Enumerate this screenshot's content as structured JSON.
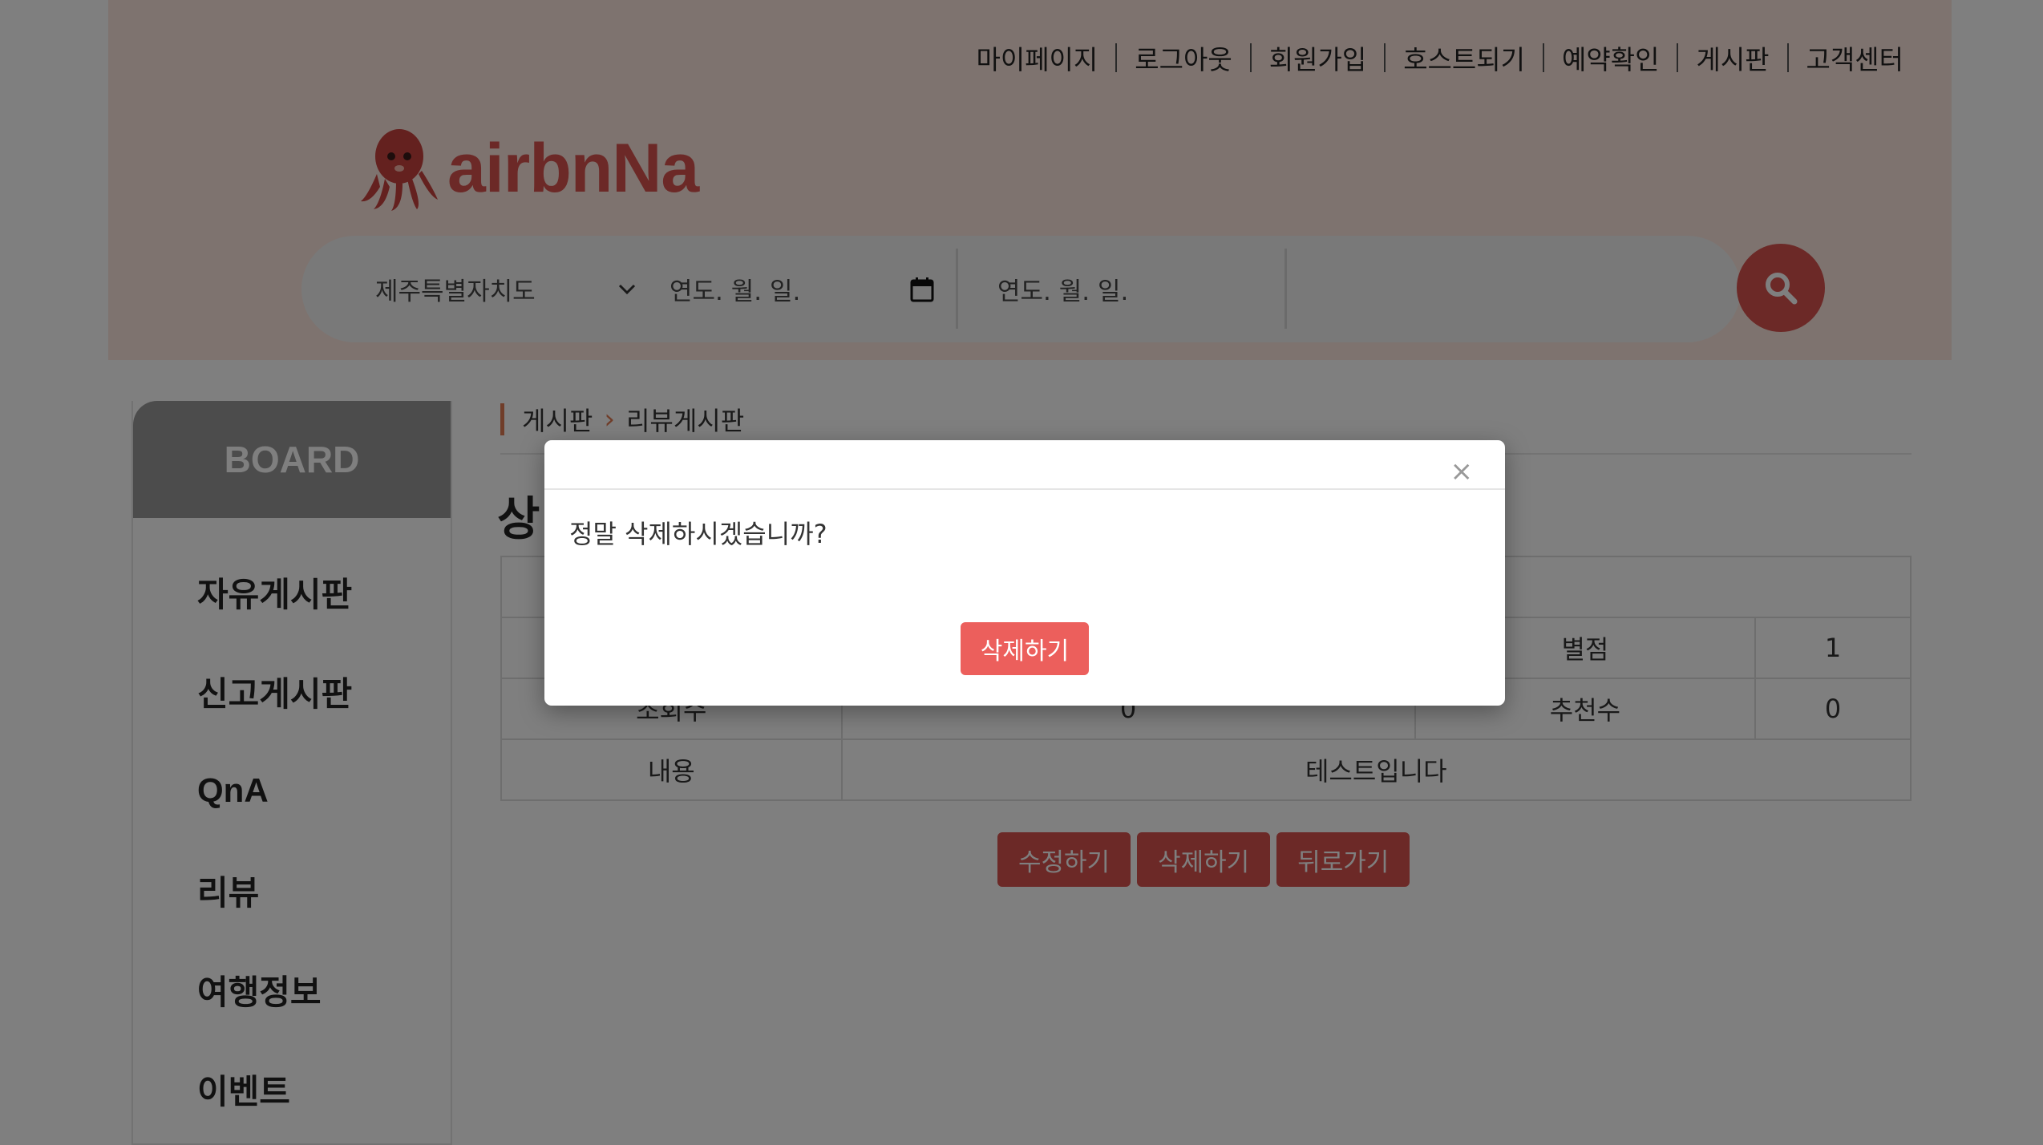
{
  "topnav": [
    "마이페이지",
    "로그아웃",
    "회원가입",
    "호스트되기",
    "예약확인",
    "게시판",
    "고객센터"
  ],
  "brand": {
    "name": "airbnNa"
  },
  "search": {
    "region": "제주특별자치도",
    "checkin_placeholder": "연도. 월. 일.",
    "checkout_placeholder": "연도. 월. 일."
  },
  "sidebar": {
    "title": "BOARD",
    "items": [
      "자유게시판",
      "신고게시판",
      "QnA",
      "리뷰",
      "여행정보",
      "이벤트"
    ]
  },
  "breadcrumb": {
    "parent": "게시판",
    "current": "리뷰게시판"
  },
  "page_title": "상",
  "detail": {
    "rating_label": "별점",
    "rating_value": "1",
    "views_label": "조회수",
    "views_value": "0",
    "likes_label": "추천수",
    "likes_value": "0",
    "content_label": "내용",
    "content_value": "테스트입니다"
  },
  "actions": {
    "edit": "수정하기",
    "delete": "삭제하기",
    "back": "뒤로가기"
  },
  "modal": {
    "close": "×",
    "message": "정말 삭제하시겠습니까?",
    "confirm": "삭제하기"
  },
  "colors": {
    "accent": "#d9534f",
    "header_bg": "#fde7df",
    "crumb_accent": "#e07a53"
  }
}
